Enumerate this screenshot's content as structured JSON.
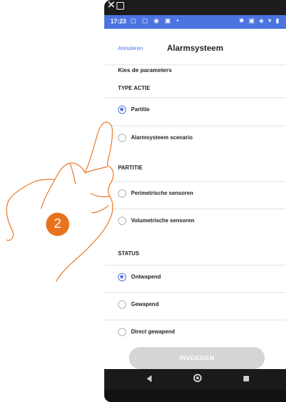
{
  "status_bar": {
    "time": "17:23"
  },
  "header": {
    "cancel_label": "Annuleren",
    "title": "Alarmsysteem"
  },
  "subtitle": "Kies de parameters",
  "sections": {
    "type_actie": {
      "label": "TYPE ACTIE",
      "options": [
        {
          "label": "Partitie",
          "selected": true
        },
        {
          "label": "Alarmsysteem scenario",
          "selected": false
        }
      ]
    },
    "partitie": {
      "label": "PARTITIE",
      "options": [
        {
          "label": "Perimetrische sensoren",
          "selected": false
        },
        {
          "label": "Volumetrische sensoren",
          "selected": false
        }
      ]
    },
    "status": {
      "label": "STATUS",
      "options": [
        {
          "label": "Ontwapend",
          "selected": true
        },
        {
          "label": "Gewapend",
          "selected": false
        },
        {
          "label": "Direct gewapend",
          "selected": false
        }
      ]
    }
  },
  "insert_button": {
    "label": "INVOEGEN"
  },
  "step_badge": "2",
  "colors": {
    "accent": "#4b74e0",
    "badge": "#e8731f"
  }
}
